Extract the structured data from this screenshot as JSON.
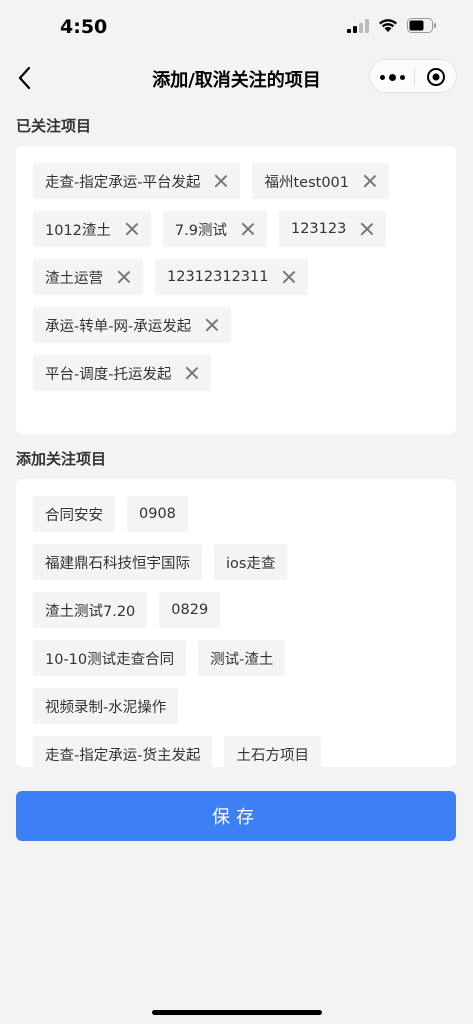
{
  "status": {
    "time": "4:50"
  },
  "nav": {
    "title": "添加/取消关注的项目"
  },
  "followed": {
    "title": "已关注项目",
    "rows": [
      [
        "走查-指定承运-平台发起",
        "福州test001"
      ],
      [
        "1012渣土",
        "7.9测试",
        "123123"
      ],
      [
        "渣土运营",
        "12312312311"
      ],
      [
        "承运-转单-网-承运发起"
      ],
      [
        "平台-调度-托运发起"
      ]
    ]
  },
  "addable": {
    "title": "添加关注项目",
    "rows": [
      [
        "合同安安",
        "0908"
      ],
      [
        "福建鼎石科技恒宇国际",
        "ios走查"
      ],
      [
        "渣土测试7.20",
        "0829"
      ],
      [
        "10-10测试走查合同",
        "测试-渣土"
      ],
      [
        "视频录制-水泥操作"
      ],
      [
        "走查-指定承运-货主发起",
        "土石方项目"
      ]
    ]
  },
  "actions": {
    "save": "保存"
  }
}
